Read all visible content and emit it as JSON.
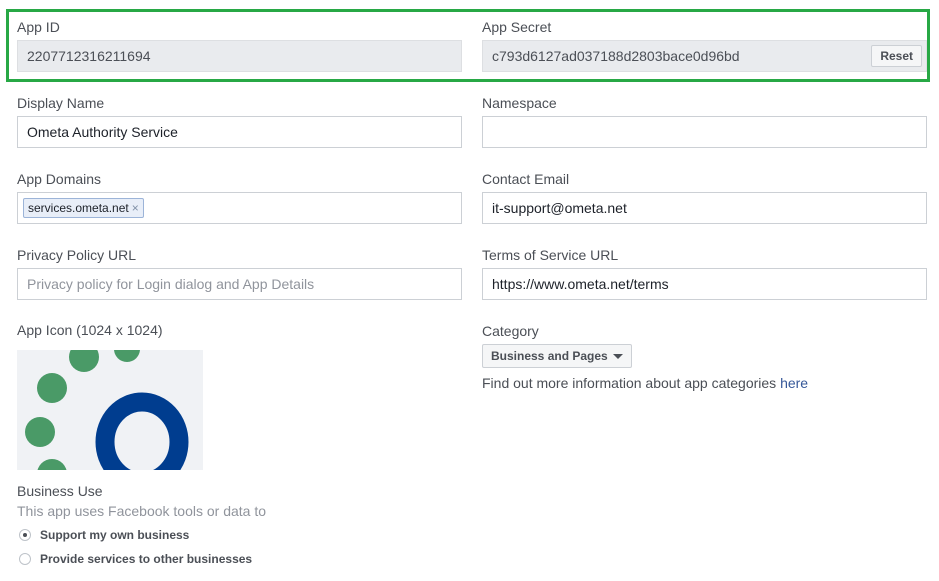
{
  "app_id": {
    "label": "App ID",
    "value": "2207712316211694"
  },
  "app_secret": {
    "label": "App Secret",
    "value": "c793d6127ad037188d2803bace0d96bd",
    "reset_label": "Reset"
  },
  "display_name": {
    "label": "Display Name",
    "value": "Ometa Authority Service"
  },
  "namespace": {
    "label": "Namespace",
    "value": ""
  },
  "app_domains": {
    "label": "App Domains",
    "tags": [
      "services.ometa.net"
    ],
    "remove_glyph": "×"
  },
  "contact_email": {
    "label": "Contact Email",
    "value": "it-support@ometa.net"
  },
  "privacy_policy": {
    "label": "Privacy Policy URL",
    "placeholder": "Privacy policy for Login dialog and App Details"
  },
  "terms_of_service": {
    "label": "Terms of Service URL",
    "value": "https://www.ometa.net/terms"
  },
  "app_icon": {
    "label": "App Icon (1024 x 1024)"
  },
  "category": {
    "label": "Category",
    "selected": "Business and Pages",
    "info_text": "Find out more information about app categories ",
    "info_link": "here"
  },
  "business_use": {
    "label": "Business Use",
    "description": "This app uses Facebook tools or data to",
    "options": [
      {
        "label": "Support my own business",
        "checked": true
      },
      {
        "label": "Provide services to other businesses",
        "checked": false
      }
    ]
  },
  "colors": {
    "highlight": "#27a845",
    "logo_green": "#4a9a67",
    "logo_blue": "#003d8f"
  }
}
